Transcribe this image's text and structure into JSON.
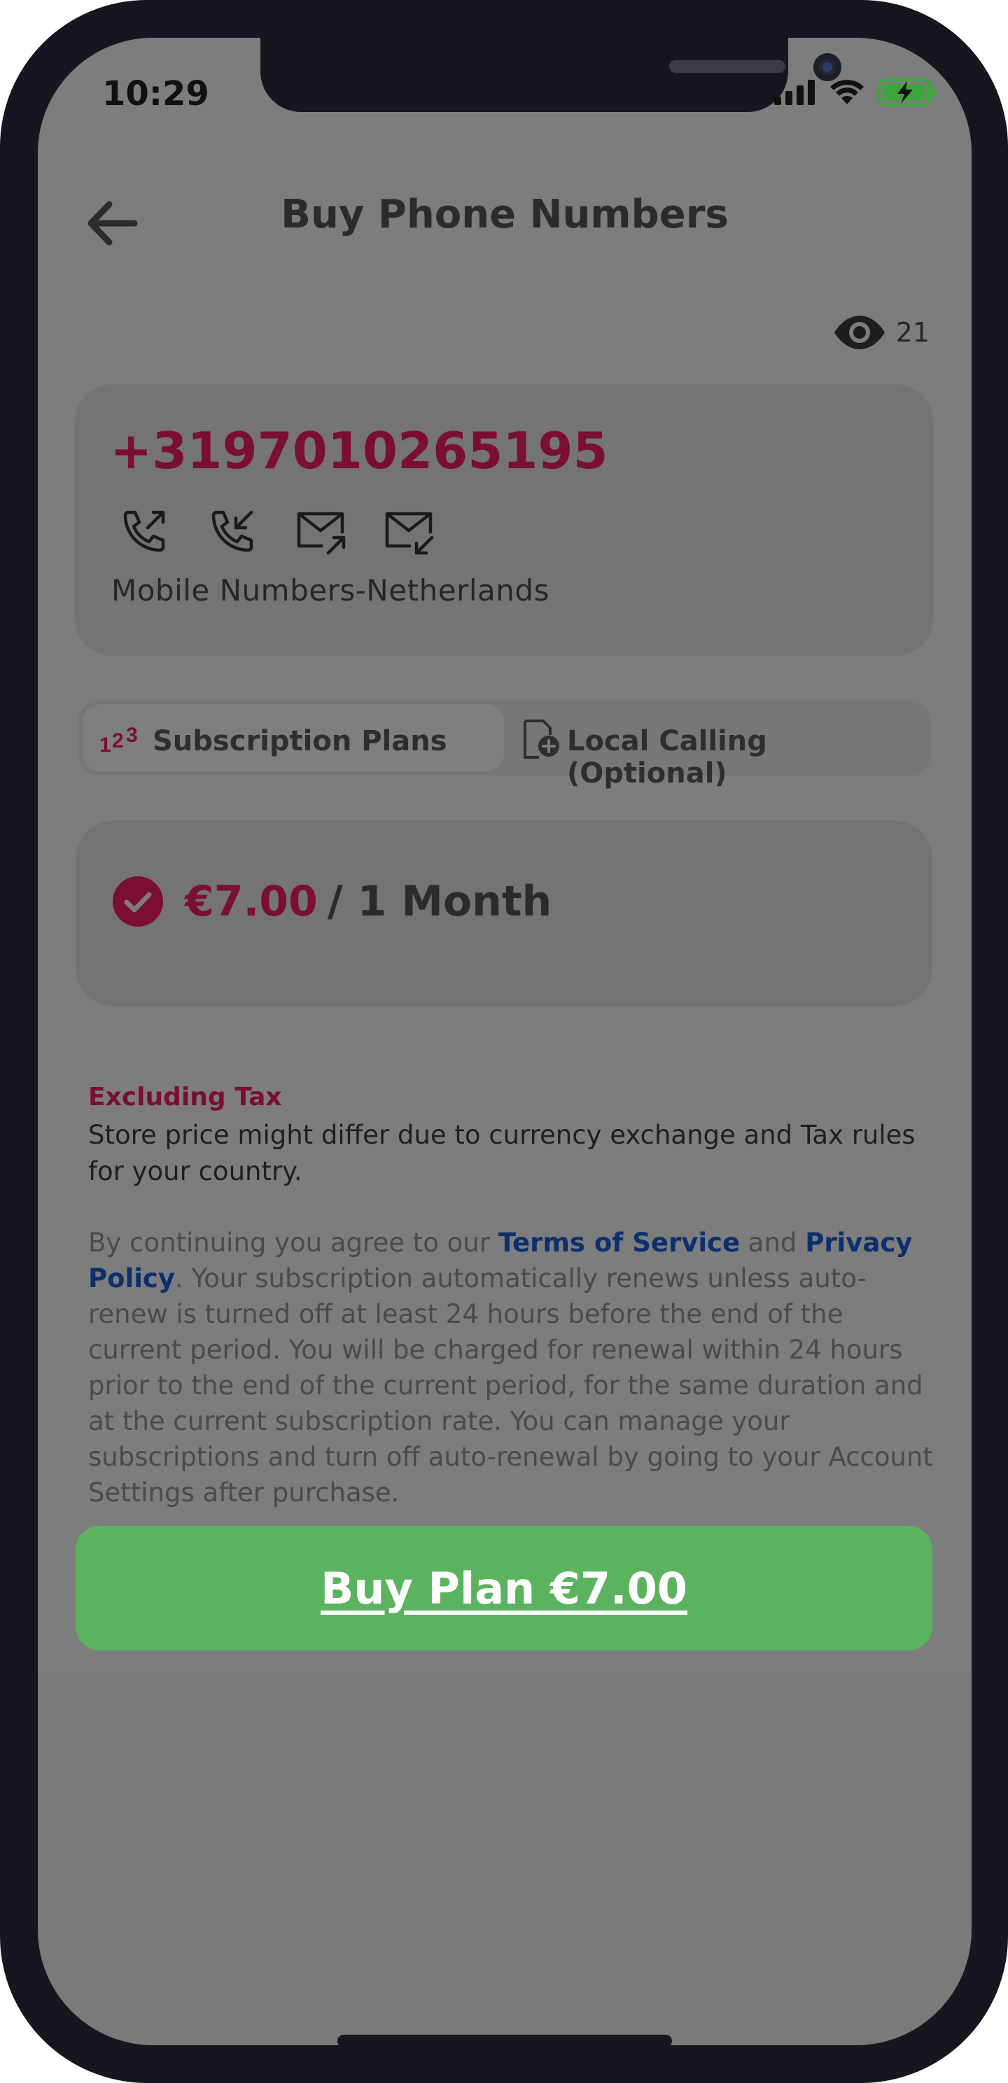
{
  "status_bar": {
    "time": "10:29"
  },
  "header": {
    "title": "Buy Phone Numbers"
  },
  "views": {
    "count": "21"
  },
  "number_card": {
    "number": "+3197010265195",
    "capabilities": [
      "outgoing-call-icon",
      "incoming-call-icon",
      "outgoing-sms-icon",
      "incoming-sms-icon"
    ],
    "category": "Mobile Numbers-Netherlands"
  },
  "tabs": {
    "subscription": "Subscription Plans",
    "local_calling": "Local Calling (Optional)"
  },
  "plan": {
    "amount": "€7.00",
    "period": "/ 1 Month",
    "selected": true
  },
  "tax": {
    "title": "Excluding Tax",
    "text": "Store price might differ due to currency exchange and Tax rules for your country."
  },
  "legal": {
    "prefix": "By continuing you agree to our ",
    "terms": "Terms of Service",
    "and": " and ",
    "privacy": "Privacy Policy",
    "body": ". Your subscription automatically renews unless auto-renew is turned off at least 24 hours before the end of the current period. You will be charged for renewal within 24 hours prior to the end of the current period, for the same duration and at the current subscription rate. You can manage your subscriptions and turn off auto-renewal by going to your Account Settings after purchase."
  },
  "buy_button": {
    "label": "Buy Plan €7.00"
  },
  "colors": {
    "accent": "#7a0e33",
    "link": "#0c2f6e",
    "buy": "#5cb35f",
    "battery": "#3ea53e"
  }
}
